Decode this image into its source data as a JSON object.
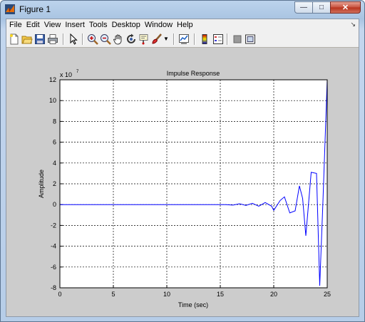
{
  "window": {
    "title": "Figure 1"
  },
  "menu": {
    "items": [
      "File",
      "Edit",
      "View",
      "Insert",
      "Tools",
      "Desktop",
      "Window",
      "Help"
    ],
    "overflow_icon": "dock-arrow-icon"
  },
  "toolbar": {
    "icons": [
      "new-figure-icon",
      "open-file-icon",
      "save-icon",
      "print-icon",
      "edit-plot-arrow-icon",
      "zoom-in-icon",
      "zoom-out-icon",
      "pan-hand-icon",
      "rotate-3d-icon",
      "data-cursor-icon",
      "brush-icon",
      "link-plot-icon",
      "insert-colorbar-icon",
      "insert-legend-icon",
      "hide-plot-tools-icon",
      "show-plot-tools-icon"
    ]
  },
  "colors": {
    "line": "#0000ff",
    "figure_bg": "#cccccc",
    "axes_bg": "#ffffff"
  },
  "chart_data": {
    "type": "line",
    "title": "Impulse Response",
    "xlabel": "Time (sec)",
    "ylabel": "Amplitude",
    "exponent_label": "x 10",
    "exponent_power": "7",
    "xlim": [
      0,
      25
    ],
    "ylim": [
      -8,
      12
    ],
    "xticks": [
      0,
      5,
      10,
      15,
      20,
      25
    ],
    "yticks": [
      -8,
      -6,
      -4,
      -2,
      0,
      2,
      4,
      6,
      8,
      10,
      12
    ],
    "grid": true,
    "series": [
      {
        "color": "#0000ff",
        "x": [
          0,
          15.5,
          16.2,
          16.8,
          17.4,
          18.0,
          18.6,
          19.2,
          19.8,
          20.0,
          20.6,
          21.0,
          21.5,
          22.0,
          22.4,
          22.7,
          23.0,
          23.5,
          24.0,
          24.3,
          24.6,
          25.0
        ],
        "y": [
          0,
          0,
          -0.05,
          0.08,
          -0.08,
          0.12,
          -0.15,
          0.2,
          -0.15,
          -0.55,
          0.4,
          0.75,
          -0.8,
          -0.6,
          1.8,
          0.6,
          -3.0,
          3.1,
          3.0,
          -7.8,
          0.3,
          12.0
        ]
      }
    ]
  }
}
